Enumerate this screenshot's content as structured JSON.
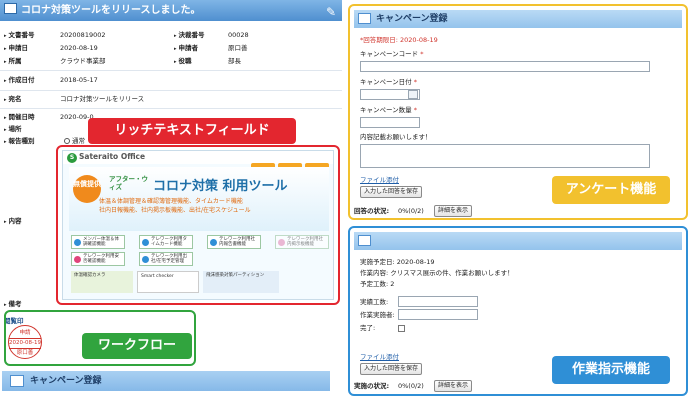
{
  "document": {
    "title": "コロナ対策ツールをリリースしました。",
    "fields": {
      "doc_no_label": "文書番号",
      "doc_no": "20200819002",
      "approval_no_label": "決裁番号",
      "approval_no": "00028",
      "apply_date_label": "申請日",
      "apply_date": "2020-08-19",
      "applicant_label": "申請者",
      "applicant": "原口善",
      "dept_label": "所属",
      "dept": "クラウド事業部",
      "role_label": "役職",
      "role": "部長",
      "created_label": "作成日付",
      "created": "2018-05-17",
      "subject_label": "宛名",
      "subject": "コロナ対策ツールをリリース",
      "event_date_label": "開催日時",
      "event_date": "2020-09-0",
      "place_label": "場所",
      "report_type_label": "報告種別",
      "report_type": "通常",
      "content_label": "内容",
      "remarks_label": "備考"
    },
    "approval_label": "閲覧印",
    "stamp": {
      "top": "申請",
      "date": "2020-08-19",
      "name": "原口善"
    }
  },
  "banner": {
    "logo": "Sateraito Office",
    "free": "無償提供",
    "after": "アフター・ウィズ",
    "headline": "コロナ対策 利用ツール",
    "sub1": "体温＆体調管理＆確認簿管理機能、タイムカード機能",
    "sub2": "社内日報機能、社内掲示板機能、出社/在宅スケジュール",
    "buttons": [
      "メンバー体温＆体調確認機能",
      "テレワーク利用タイムカード機能",
      "テレワーク利用社内報告書機能",
      "テレワーク利用社内掲示板機能",
      "テレワーク利用安否確認機能",
      "テレワーク利用出社/在宅予定管理"
    ],
    "tiles": [
      "体温確認カメラ",
      "Smart checker",
      "飛沫感染対策パーティション"
    ]
  },
  "callouts": {
    "richtext": "リッチテキストフィールド",
    "workflow": "ワークフロー",
    "survey": "アンケート機能",
    "task": "作業指示機能"
  },
  "campaign_bar": "キャンペーン登録",
  "survey_panel": {
    "title": "キャンペーン登録",
    "deadline": "*回答期限日: 2020-08-19",
    "code_label": "キャンペーンコード",
    "date_label": "キャンペーン日付",
    "qty_label": "キャンペーン数量",
    "note_label": "内容記載お願いします！",
    "attach_link": "ファイル添付",
    "save_button": "入力した回答を保存",
    "status_label": "回答の状況:",
    "status_value": "0%(0/2)",
    "detail_button": "詳細を表示"
  },
  "task_panel": {
    "plan_date_label": "実施予定日:",
    "plan_date": "2020-08-19",
    "work_label": "作業内容:",
    "work": "クリスマス展示の件、作業お願いします！",
    "count_label": "予定工数:",
    "count": "2",
    "actual_label": "実績工数:",
    "worker_label": "作業実施者:",
    "done_label": "完了:",
    "attach_link": "ファイル添付",
    "save_button": "入力した回答を保存",
    "status_label": "実施の状況:",
    "status_value": "0%(0/2)",
    "detail_button": "詳細を表示"
  },
  "colors": {
    "richtext_red": "#e3262f",
    "workflow_green": "#31a43e",
    "survey_yellow": "#f2c12e",
    "task_blue": "#2f8fd6"
  }
}
